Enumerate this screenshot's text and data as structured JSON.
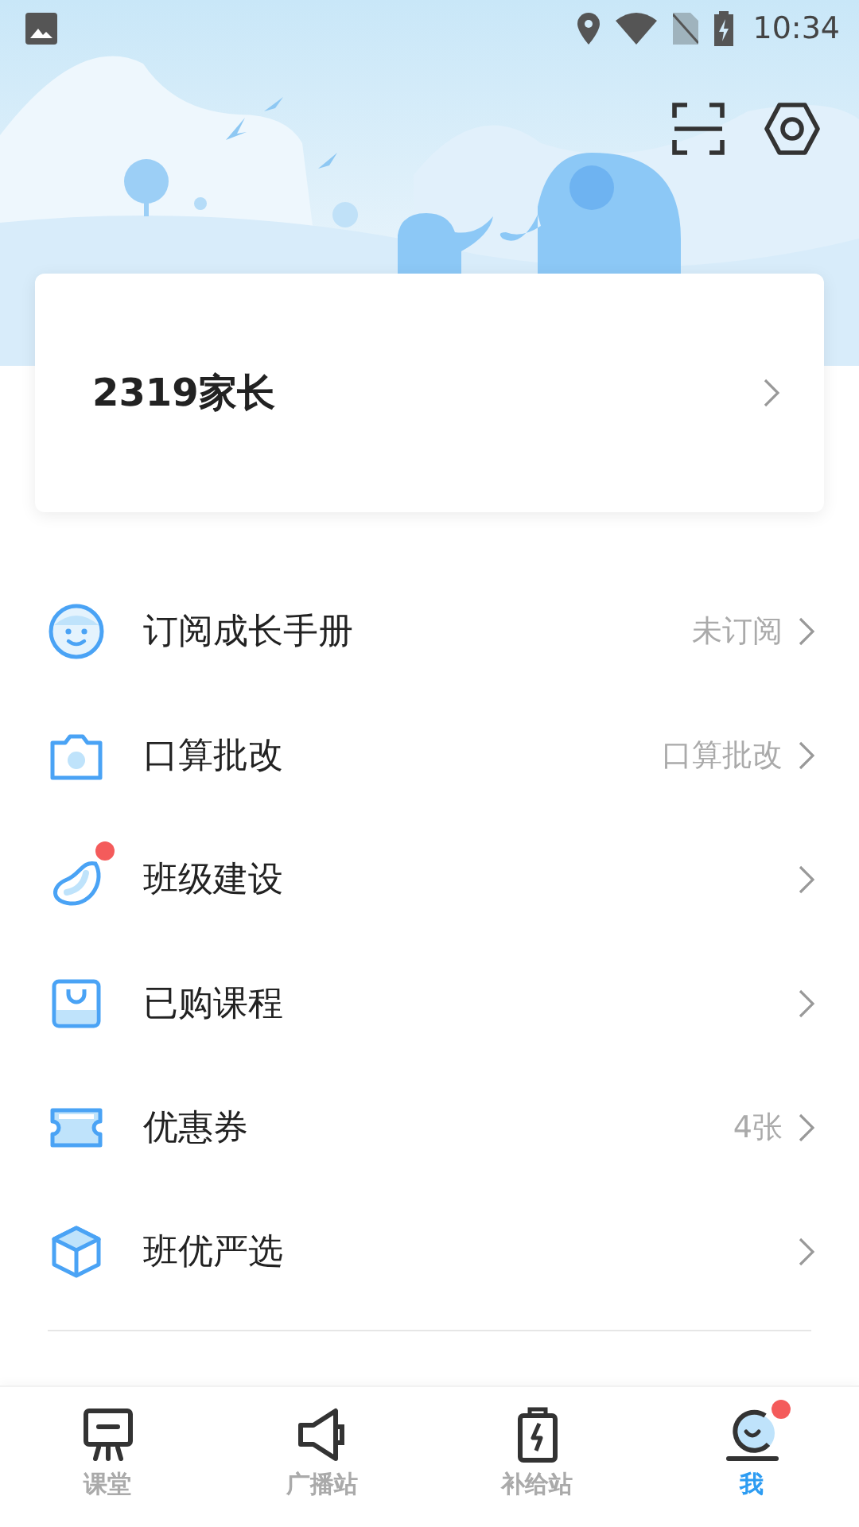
{
  "status_bar": {
    "time": "10:34"
  },
  "profile": {
    "name": "2319家长"
  },
  "menu": [
    {
      "label": "订阅成长手册",
      "value": "未订阅",
      "badge": false
    },
    {
      "label": "口算批改",
      "value": "口算批改",
      "badge": false
    },
    {
      "label": "班级建设",
      "badge": true
    },
    {
      "label": "已购课程",
      "badge": false
    },
    {
      "label": "优惠券",
      "value": "4张",
      "badge": false
    },
    {
      "label": "班优严选",
      "badge": false
    }
  ],
  "tabs": [
    {
      "label": "课堂",
      "selected": false,
      "badge": false
    },
    {
      "label": "广播站",
      "selected": false,
      "badge": false
    },
    {
      "label": "补给站",
      "selected": false,
      "badge": false
    },
    {
      "label": "我",
      "selected": true,
      "badge": true
    }
  ]
}
